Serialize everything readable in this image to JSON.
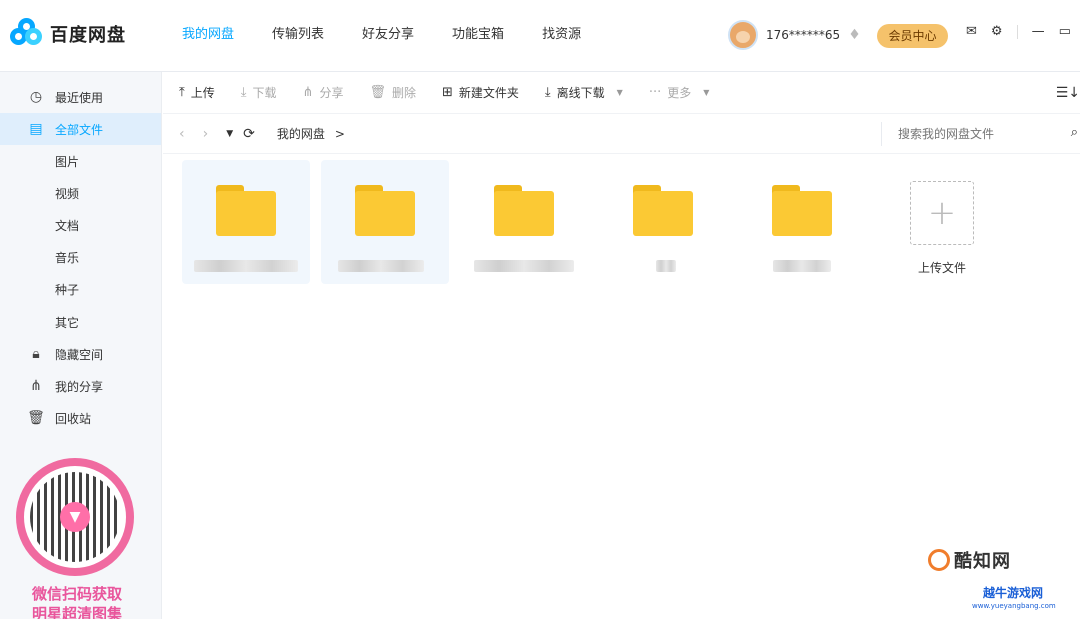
{
  "app": {
    "name": "百度网盘"
  },
  "nav": {
    "tabs": [
      {
        "label": "我的网盘",
        "active": true
      },
      {
        "label": "传输列表"
      },
      {
        "label": "好友分享"
      },
      {
        "label": "功能宝箱"
      },
      {
        "label": "找资源"
      }
    ]
  },
  "user": {
    "name": "176******65",
    "vip_button": "会员中心"
  },
  "sidebar": {
    "items": [
      {
        "label": "最近使用",
        "icon": "clock-icon"
      },
      {
        "label": "全部文件",
        "icon": "document-icon",
        "active": true
      },
      {
        "label": "图片"
      },
      {
        "label": "视频"
      },
      {
        "label": "文档"
      },
      {
        "label": "音乐"
      },
      {
        "label": "种子"
      },
      {
        "label": "其它"
      },
      {
        "label": "隐藏空间",
        "icon": "lock-icon"
      },
      {
        "label": "我的分享",
        "icon": "share-icon"
      },
      {
        "label": "回收站",
        "icon": "trash-icon"
      }
    ],
    "promo": {
      "line1": "微信扫码获取",
      "line2": "明星超清图集"
    }
  },
  "toolbar": {
    "upload": "上传",
    "download": "下载",
    "share": "分享",
    "delete": "删除",
    "new_folder": "新建文件夹",
    "offline_download": "离线下载",
    "more": "更多"
  },
  "pathbar": {
    "crumb": "我的网盘",
    "separator": ">",
    "search_placeholder": "搜索我的网盘文件"
  },
  "files": {
    "count": 5,
    "upload_label": "上传文件"
  },
  "watermark": {
    "site1": "酷知网",
    "site2": "越牛游戏网",
    "site2_url": "www.yueyangbang.com"
  },
  "colors": {
    "accent": "#06a7ff",
    "folder": "#fbc934",
    "vip": "#f5c26b",
    "promo": "#e9559c"
  }
}
